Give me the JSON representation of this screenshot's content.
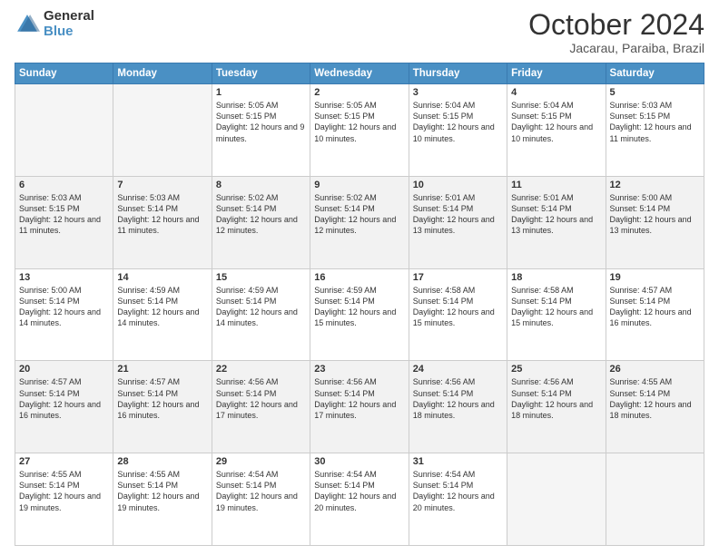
{
  "logo": {
    "general": "General",
    "blue": "Blue"
  },
  "title": {
    "month": "October 2024",
    "location": "Jacarau, Paraiba, Brazil"
  },
  "days_of_week": [
    "Sunday",
    "Monday",
    "Tuesday",
    "Wednesday",
    "Thursday",
    "Friday",
    "Saturday"
  ],
  "weeks": [
    [
      {
        "day": "",
        "info": ""
      },
      {
        "day": "",
        "info": ""
      },
      {
        "day": "1",
        "sunrise": "5:05 AM",
        "sunset": "5:15 PM",
        "daylight": "12 hours and 9 minutes."
      },
      {
        "day": "2",
        "sunrise": "5:05 AM",
        "sunset": "5:15 PM",
        "daylight": "12 hours and 10 minutes."
      },
      {
        "day": "3",
        "sunrise": "5:04 AM",
        "sunset": "5:15 PM",
        "daylight": "12 hours and 10 minutes."
      },
      {
        "day": "4",
        "sunrise": "5:04 AM",
        "sunset": "5:15 PM",
        "daylight": "12 hours and 10 minutes."
      },
      {
        "day": "5",
        "sunrise": "5:03 AM",
        "sunset": "5:15 PM",
        "daylight": "12 hours and 11 minutes."
      }
    ],
    [
      {
        "day": "6",
        "sunrise": "5:03 AM",
        "sunset": "5:15 PM",
        "daylight": "12 hours and 11 minutes."
      },
      {
        "day": "7",
        "sunrise": "5:03 AM",
        "sunset": "5:14 PM",
        "daylight": "12 hours and 11 minutes."
      },
      {
        "day": "8",
        "sunrise": "5:02 AM",
        "sunset": "5:14 PM",
        "daylight": "12 hours and 12 minutes."
      },
      {
        "day": "9",
        "sunrise": "5:02 AM",
        "sunset": "5:14 PM",
        "daylight": "12 hours and 12 minutes."
      },
      {
        "day": "10",
        "sunrise": "5:01 AM",
        "sunset": "5:14 PM",
        "daylight": "12 hours and 13 minutes."
      },
      {
        "day": "11",
        "sunrise": "5:01 AM",
        "sunset": "5:14 PM",
        "daylight": "12 hours and 13 minutes."
      },
      {
        "day": "12",
        "sunrise": "5:00 AM",
        "sunset": "5:14 PM",
        "daylight": "12 hours and 13 minutes."
      }
    ],
    [
      {
        "day": "13",
        "sunrise": "5:00 AM",
        "sunset": "5:14 PM",
        "daylight": "12 hours and 14 minutes."
      },
      {
        "day": "14",
        "sunrise": "4:59 AM",
        "sunset": "5:14 PM",
        "daylight": "12 hours and 14 minutes."
      },
      {
        "day": "15",
        "sunrise": "4:59 AM",
        "sunset": "5:14 PM",
        "daylight": "12 hours and 14 minutes."
      },
      {
        "day": "16",
        "sunrise": "4:59 AM",
        "sunset": "5:14 PM",
        "daylight": "12 hours and 15 minutes."
      },
      {
        "day": "17",
        "sunrise": "4:58 AM",
        "sunset": "5:14 PM",
        "daylight": "12 hours and 15 minutes."
      },
      {
        "day": "18",
        "sunrise": "4:58 AM",
        "sunset": "5:14 PM",
        "daylight": "12 hours and 15 minutes."
      },
      {
        "day": "19",
        "sunrise": "4:57 AM",
        "sunset": "5:14 PM",
        "daylight": "12 hours and 16 minutes."
      }
    ],
    [
      {
        "day": "20",
        "sunrise": "4:57 AM",
        "sunset": "5:14 PM",
        "daylight": "12 hours and 16 minutes."
      },
      {
        "day": "21",
        "sunrise": "4:57 AM",
        "sunset": "5:14 PM",
        "daylight": "12 hours and 16 minutes."
      },
      {
        "day": "22",
        "sunrise": "4:56 AM",
        "sunset": "5:14 PM",
        "daylight": "12 hours and 17 minutes."
      },
      {
        "day": "23",
        "sunrise": "4:56 AM",
        "sunset": "5:14 PM",
        "daylight": "12 hours and 17 minutes."
      },
      {
        "day": "24",
        "sunrise": "4:56 AM",
        "sunset": "5:14 PM",
        "daylight": "12 hours and 18 minutes."
      },
      {
        "day": "25",
        "sunrise": "4:56 AM",
        "sunset": "5:14 PM",
        "daylight": "12 hours and 18 minutes."
      },
      {
        "day": "26",
        "sunrise": "4:55 AM",
        "sunset": "5:14 PM",
        "daylight": "12 hours and 18 minutes."
      }
    ],
    [
      {
        "day": "27",
        "sunrise": "4:55 AM",
        "sunset": "5:14 PM",
        "daylight": "12 hours and 19 minutes."
      },
      {
        "day": "28",
        "sunrise": "4:55 AM",
        "sunset": "5:14 PM",
        "daylight": "12 hours and 19 minutes."
      },
      {
        "day": "29",
        "sunrise": "4:54 AM",
        "sunset": "5:14 PM",
        "daylight": "12 hours and 19 minutes."
      },
      {
        "day": "30",
        "sunrise": "4:54 AM",
        "sunset": "5:14 PM",
        "daylight": "12 hours and 20 minutes."
      },
      {
        "day": "31",
        "sunrise": "4:54 AM",
        "sunset": "5:14 PM",
        "daylight": "12 hours and 20 minutes."
      },
      {
        "day": "",
        "info": ""
      },
      {
        "day": "",
        "info": ""
      }
    ]
  ]
}
